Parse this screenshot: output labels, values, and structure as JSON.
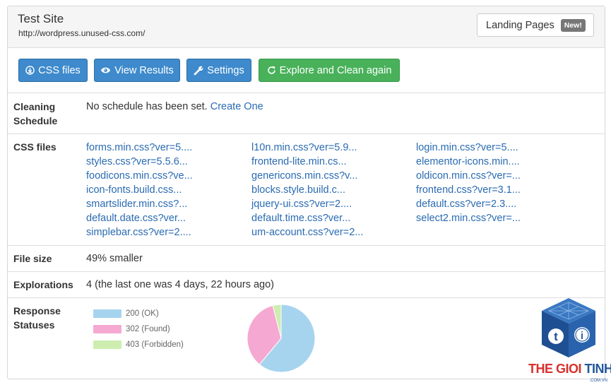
{
  "header": {
    "site_title": "Test Site",
    "site_url": "http://wordpress.unused-css.com/",
    "landing_pages_label": "Landing Pages",
    "new_badge": "New!"
  },
  "toolbar": {
    "css_files_label": "CSS files",
    "view_results_label": "View Results",
    "settings_label": "Settings",
    "explore_label": "Explore and Clean again",
    "primary_color": "#3e8acc",
    "success_color": "#48b15a"
  },
  "cleaning": {
    "label_line1": "Cleaning",
    "label_line2": "Schedule",
    "value": "No schedule has been set.",
    "link": "Create One"
  },
  "css_files": {
    "label": "CSS files",
    "columns": [
      [
        "forms.min.css?ver=5....",
        "styles.css?ver=5.5.6...",
        "foodicons.min.css?ve...",
        "icon-fonts.build.css...",
        "smartslider.min.css?...",
        "default.date.css?ver...",
        "simplebar.css?ver=2...."
      ],
      [
        "l10n.min.css?ver=5.9...",
        "frontend-lite.min.cs...",
        "genericons.min.css?v...",
        "blocks.style.build.c...",
        "jquery-ui.css?ver=2....",
        "default.time.css?ver...",
        "um-account.css?ver=2..."
      ],
      [
        "login.min.css?ver=5....",
        "elementor-icons.min....",
        "oldicon.min.css?ver=...",
        "frontend.css?ver=3.1...",
        "default.css?ver=2.3....",
        "select2.min.css?ver=..."
      ]
    ]
  },
  "file_size": {
    "label": "File size",
    "value": "49% smaller"
  },
  "explorations": {
    "label": "Explorations",
    "value": "4 (the last one was 4 days, 22 hours ago)"
  },
  "response": {
    "label_line1": "Response",
    "label_line2": "Statuses"
  },
  "chart_data": {
    "type": "pie",
    "series": [
      {
        "name": "200 (OK)",
        "value": 61,
        "color": "#a6d4ef"
      },
      {
        "name": "302 (Found)",
        "value": 35,
        "color": "#f5a9d2"
      },
      {
        "name": "403 (Forbidden)",
        "value": 4,
        "color": "#cdeeb0"
      }
    ],
    "legend_position": "left"
  },
  "watermark": {
    "text_red": "THE GIOI",
    "text_blue": "TINHOC",
    "sub": ".COM.VN"
  }
}
